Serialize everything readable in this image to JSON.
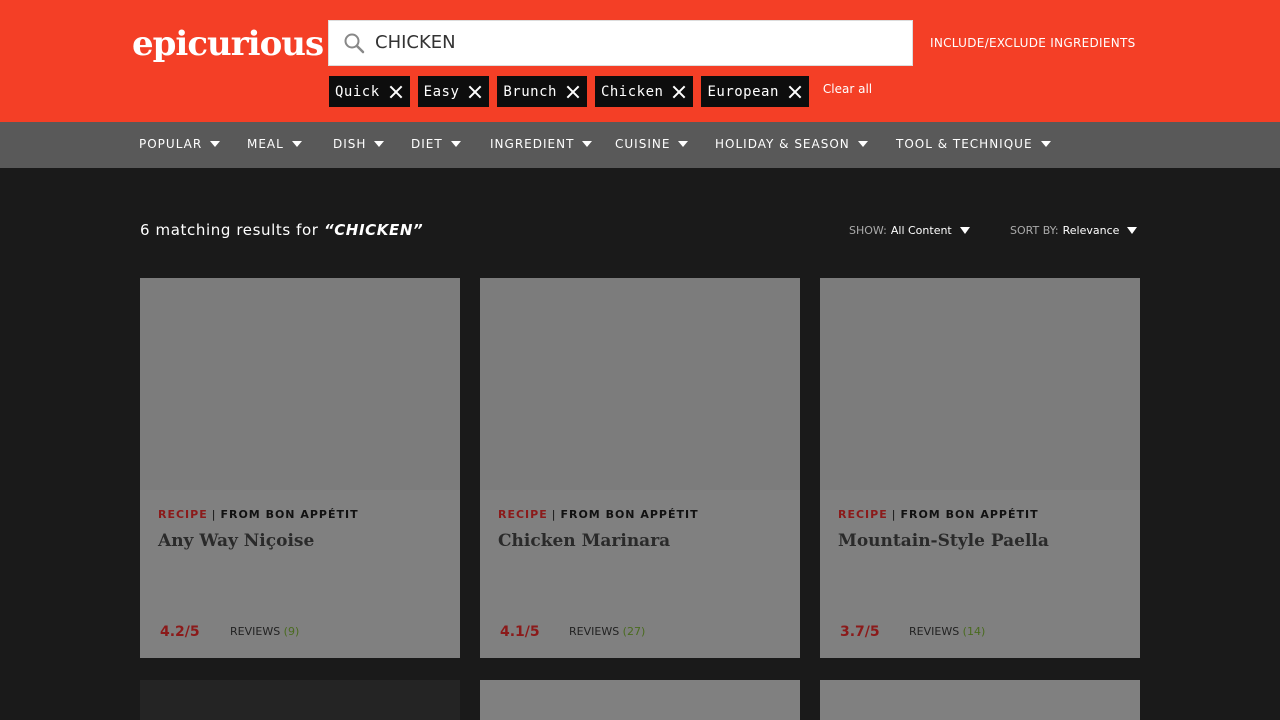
{
  "header": {
    "logo": "epicurious",
    "search_value": "CHICKEN",
    "include_exclude": "INCLUDE/EXCLUDE INGREDIENTS",
    "chips": [
      "Quick",
      "Easy",
      "Brunch",
      "Chicken",
      "European"
    ],
    "clear_all": "Clear all"
  },
  "nav": {
    "items": [
      "POPULAR",
      "MEAL",
      "DISH",
      "DIET",
      "INGREDIENT",
      "CUISINE",
      "HOLIDAY & SEASON",
      "TOOL & TECHNIQUE"
    ]
  },
  "results": {
    "prefix": "6 matching results for ",
    "query": "“CHICKEN”",
    "show_label": "SHOW:",
    "show_value": "All Content",
    "sort_label": "SORT BY:",
    "sort_value": "Relevance"
  },
  "cards": [
    {
      "type": "RECIPE",
      "separator": "|",
      "source": "FROM BON APPÉTIT",
      "title": "Any Way Niçoise",
      "rating": "4.2/5",
      "reviews_label": "REVIEWS",
      "reviews_count": "(9)"
    },
    {
      "type": "RECIPE",
      "separator": "|",
      "source": "FROM BON APPÉTIT",
      "title": "Chicken Marinara",
      "rating": "4.1/5",
      "reviews_label": "REVIEWS",
      "reviews_count": "(27)"
    },
    {
      "type": "RECIPE",
      "separator": "|",
      "source": "FROM BON APPÉTIT",
      "title": "Mountain-Style Paella",
      "rating": "3.7/5",
      "reviews_label": "REVIEWS",
      "reviews_count": "(14)"
    }
  ],
  "colors": {
    "brand": "#f43f26",
    "nav_bg": "#595959",
    "page_bg": "#1a1a1a",
    "card_bg": "#808080",
    "rating": "#8b1a1a"
  }
}
